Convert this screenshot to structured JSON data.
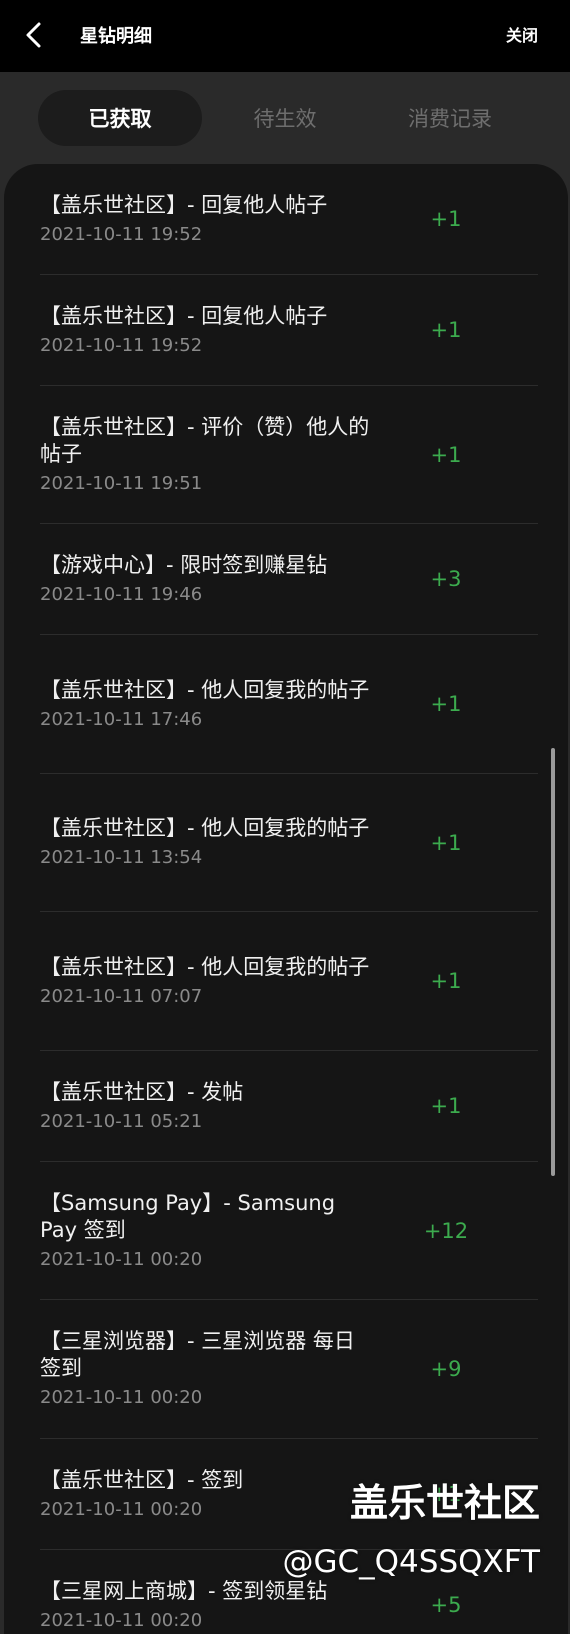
{
  "header": {
    "back_icon": "chevron-left-icon",
    "title": "星钻明细",
    "close_label": "关闭"
  },
  "tabs": [
    {
      "label": "已获取",
      "active": true
    },
    {
      "label": "待生效",
      "active": false
    },
    {
      "label": "消费记录",
      "active": false
    }
  ],
  "colors": {
    "background": "#2a2a2a",
    "header": "#000000",
    "card": "#151515",
    "points": "#3cab4e"
  },
  "items": [
    {
      "title": "【盖乐世社区】- 回复他人帖子",
      "time": "2021-10-11 19:52",
      "points": "+1"
    },
    {
      "title": "【盖乐世社区】- 回复他人帖子",
      "time": "2021-10-11 19:52",
      "points": "+1"
    },
    {
      "title": "【盖乐世社区】- 评价（赞）他人的帖子",
      "time": "2021-10-11 19:51",
      "points": "+1"
    },
    {
      "title": "【游戏中心】- 限时签到赚星钻",
      "time": "2021-10-11 19:46",
      "points": "+3"
    },
    {
      "title": "【盖乐世社区】- 他人回复我的帖子",
      "time": "2021-10-11 17:46",
      "points": "+1"
    },
    {
      "title": "【盖乐世社区】- 他人回复我的帖子",
      "time": "2021-10-11 13:54",
      "points": "+1"
    },
    {
      "title": "【盖乐世社区】- 他人回复我的帖子",
      "time": "2021-10-11 07:07",
      "points": "+1"
    },
    {
      "title": "【盖乐世社区】- 发帖",
      "time": "2021-10-11 05:21",
      "points": "+1"
    },
    {
      "title": "【Samsung Pay】- Samsung Pay 签到",
      "time": "2021-10-11 00:20",
      "points": "+12"
    },
    {
      "title": "【三星浏览器】- 三星浏览器 每日签到",
      "time": "2021-10-11 00:20",
      "points": "+9"
    },
    {
      "title": "【盖乐世社区】- 签到",
      "time": "2021-10-11 00:20",
      "points": "+1"
    },
    {
      "title": "【三星网上商城】- 签到领星钻",
      "time": "2021-10-11 00:20",
      "points": "+5"
    }
  ],
  "watermark": {
    "title": "盖乐世社区",
    "user": "@GC_Q4SSQXFT"
  }
}
